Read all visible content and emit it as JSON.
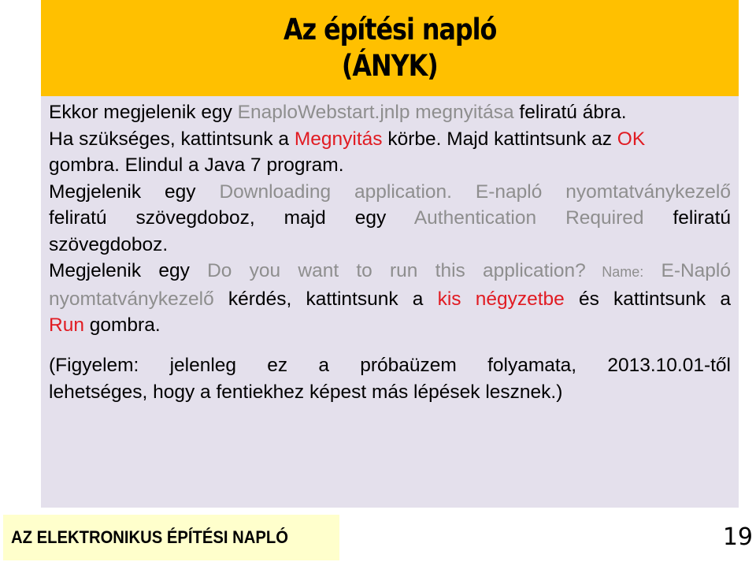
{
  "slide": {
    "title_lines": [
      "Az építési napló",
      "(ÁNYK)"
    ],
    "colors": {
      "title_band": "#ffc000",
      "body_panel": "#e4e0ec",
      "footer_box": "#ffffcc",
      "highlight_gray": "#8e8e8e",
      "highlight_red": "#e11b22"
    },
    "paragraph1": {
      "l1": {
        "a": "Ekkor megjelenik egy ",
        "b": "EnaploWebstart.jnlp megnyitása",
        "c": " feliratú ábra."
      },
      "l2": {
        "a": "Ha szükséges, kattintsunk a ",
        "b": "Megnyitás",
        "c": " körbe. Majd kattintsunk az ",
        "d": "OK"
      },
      "l3": {
        "a": "gombra. Elindul a Java 7 program."
      },
      "l4": {
        "a": "Megjelenik egy ",
        "b": "Downloading application. E-napló nyomtatványkezelő"
      },
      "l5": {
        "a": "feliratú szövegdoboz, majd egy ",
        "b": "Authentication Required",
        "c": " feliratú"
      },
      "l6": {
        "a": "szövegdoboz."
      },
      "l7": {
        "a": "Megjelenik egy ",
        "b": "Do you want to run this application?",
        "c": " Name:",
        "d": " E-Napló"
      },
      "l8": {
        "a": "nyomtatványkezelő",
        "b": " kérdés, kattintsunk a ",
        "c": "kis négyzetbe",
        "d": " és kattintsunk a"
      },
      "l9": {
        "a": "Run",
        "b": " gombra."
      }
    },
    "paragraph2": {
      "l1": "(Figyelem: jelenleg ez a próbaüzem folyamata, 2013.10.01-től",
      "l2": "lehetséges, hogy a fentiekhez képest más lépések lesznek.)"
    },
    "footer": {
      "label": "AZ ELEKTRONIKUS ÉPÍTÉSI NAPLÓ",
      "slide_number": "19"
    }
  }
}
